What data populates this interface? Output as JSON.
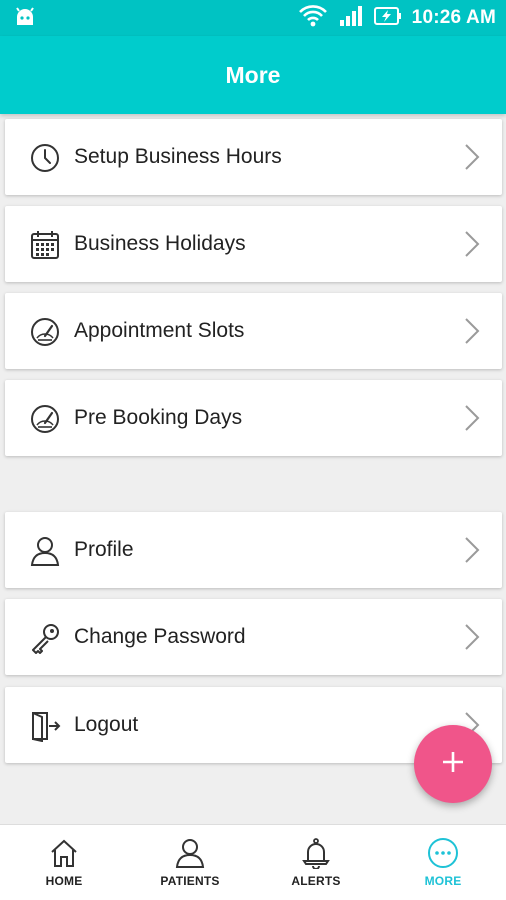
{
  "status_bar": {
    "time": "10:26 AM",
    "icons": [
      "android-icon",
      "wifi-icon",
      "signal-icon",
      "battery-charging-icon"
    ]
  },
  "header": {
    "title": "More"
  },
  "menu": {
    "items": [
      {
        "label": "Setup Business Hours",
        "icon": "clock-icon"
      },
      {
        "label": "Business Holidays",
        "icon": "calendar-icon"
      },
      {
        "label": "Appointment Slots",
        "icon": "gauge-icon"
      },
      {
        "label": "Pre Booking Days",
        "icon": "gauge-icon"
      },
      {
        "label": "Profile",
        "icon": "person-icon"
      },
      {
        "label": "Change Password",
        "icon": "key-icon"
      },
      {
        "label": "Logout",
        "icon": "door-exit-icon"
      }
    ]
  },
  "fab": {
    "icon": "plus-icon",
    "color": "#f0558a"
  },
  "bottom_nav": {
    "items": [
      {
        "label": "HOME",
        "icon": "home-icon",
        "active": false
      },
      {
        "label": "PATIENTS",
        "icon": "person-icon",
        "active": false
      },
      {
        "label": "ALERTS",
        "icon": "bell-icon",
        "active": false
      },
      {
        "label": "MORE",
        "icon": "more-dots-icon",
        "active": true
      }
    ]
  },
  "colors": {
    "primary": "#00cccc",
    "status_bar": "#00c3c3",
    "accent": "#f0558a",
    "active_nav": "#1ec2d6",
    "background": "#efefef"
  }
}
